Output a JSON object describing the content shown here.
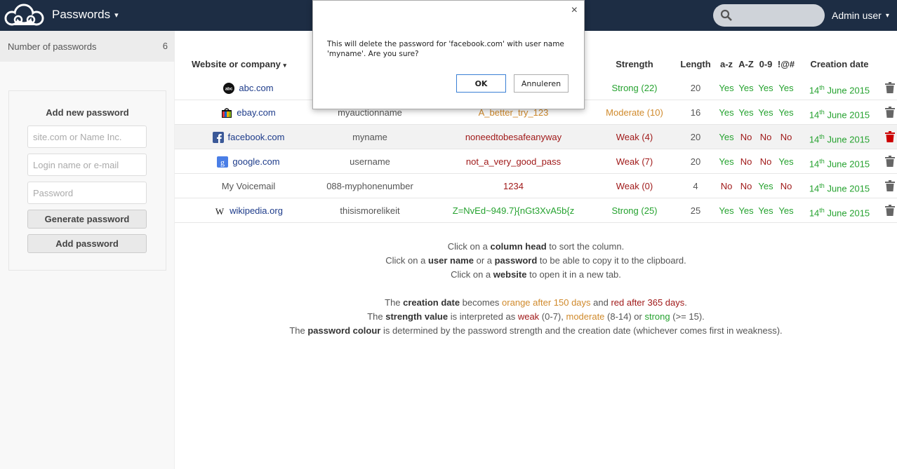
{
  "header": {
    "app_title": "Passwords",
    "caret": "▾",
    "search_placeholder": "",
    "user_name": "Admin user",
    "colors": {
      "bar": "#1d2d44"
    }
  },
  "sidebar": {
    "count_label": "Number of passwords",
    "count_value": "6",
    "add_title": "Add new password",
    "site_placeholder": "site.com or Name Inc.",
    "login_placeholder": "Login name or e-mail",
    "password_placeholder": "Password",
    "generate_button": "Generate password",
    "add_button": "Add password"
  },
  "table": {
    "headers": {
      "website": "Website or company",
      "website_caret": "▾",
      "strength": "Strength",
      "length": "Length",
      "az": "a-z",
      "AZ": "A-Z",
      "digits": "0-9",
      "special": "!@#",
      "created": "Creation date"
    },
    "rows": [
      {
        "website": "abc.com",
        "icon": "abc-icon",
        "link": true,
        "user": "",
        "password": "",
        "password_color": "green",
        "strength": "Strong (22)",
        "strength_color": "green",
        "length": "20",
        "az": "Yes",
        "AZ": "Yes",
        "digits": "Yes",
        "special": "Yes",
        "day": "14",
        "sup": "th",
        "month_year": "June 2015",
        "selected": false
      },
      {
        "website": "ebay.com",
        "icon": "ebay-icon",
        "link": true,
        "user": "myauctionname",
        "password": "A_better_try_123",
        "password_color": "orange",
        "strength": "Moderate (10)",
        "strength_color": "orange",
        "length": "16",
        "az": "Yes",
        "AZ": "Yes",
        "digits": "Yes",
        "special": "Yes",
        "day": "14",
        "sup": "th",
        "month_year": "June 2015",
        "selected": false
      },
      {
        "website": "facebook.com",
        "icon": "facebook-icon",
        "link": true,
        "user": "myname",
        "password": "noneedtobesafeanyway",
        "password_color": "red",
        "strength": "Weak (4)",
        "strength_color": "red",
        "length": "20",
        "az": "Yes",
        "AZ": "No",
        "digits": "No",
        "special": "No",
        "day": "14",
        "sup": "th",
        "month_year": "June 2015",
        "selected": true
      },
      {
        "website": "google.com",
        "icon": "google-icon",
        "link": true,
        "user": "username",
        "password": "not_a_very_good_pass",
        "password_color": "red",
        "strength": "Weak (7)",
        "strength_color": "red",
        "length": "20",
        "az": "Yes",
        "AZ": "No",
        "digits": "No",
        "special": "Yes",
        "day": "14",
        "sup": "th",
        "month_year": "June 2015",
        "selected": false
      },
      {
        "website": "My Voicemail",
        "icon": "",
        "link": false,
        "user": "088-myphonenumber",
        "password": "1234",
        "password_color": "red",
        "strength": "Weak (0)",
        "strength_color": "red",
        "length": "4",
        "az": "No",
        "AZ": "No",
        "digits": "Yes",
        "special": "No",
        "day": "14",
        "sup": "th",
        "month_year": "June 2015",
        "selected": false
      },
      {
        "website": "wikipedia.org",
        "icon": "wikipedia-icon",
        "link": true,
        "user": "thisismorelikeit",
        "password": "Z=NvEd~949.7}{nGt3XvA5b{z",
        "password_color": "green",
        "strength": "Strong (25)",
        "strength_color": "green",
        "length": "25",
        "az": "Yes",
        "AZ": "Yes",
        "digits": "Yes",
        "special": "Yes",
        "day": "14",
        "sup": "th",
        "month_year": "June 2015",
        "selected": false
      }
    ]
  },
  "info": {
    "l1_a": "Click on a ",
    "l1_b": "column head",
    "l1_c": " to sort the column.",
    "l2_a": "Click on a ",
    "l2_b": "user name",
    "l2_c": " or a ",
    "l2_d": "password",
    "l2_e": " to be able to copy it to the clipboard.",
    "l3_a": "Click on a ",
    "l3_b": "website",
    "l3_c": " to open it in a new tab.",
    "l4_a": "The ",
    "l4_b": "creation date",
    "l4_c": " becomes ",
    "l4_d": "orange after 150 days",
    "l4_e": " and ",
    "l4_f": "red after 365 days",
    "l4_g": ".",
    "l5_a": "The ",
    "l5_b": "strength value",
    "l5_c": " is interpreted as ",
    "l5_d": "weak",
    "l5_e": " (0-7), ",
    "l5_f": "moderate",
    "l5_g": " (8-14) or ",
    "l5_h": "strong",
    "l5_i": " (>= 15).",
    "l6_a": "The ",
    "l6_b": "password colour",
    "l6_c": " is determined by the password strength and the creation date (whichever comes first in weakness)."
  },
  "dialog": {
    "close": "×",
    "message": "This will delete the password for 'facebook.com' with user name 'myname'. Are you sure?",
    "ok": "OK",
    "cancel": "Annuleren"
  },
  "colors": {
    "green": "#25a22f",
    "red": "#a01a1a",
    "orange": "#d08a2c",
    "link": "#1d3b8a"
  }
}
